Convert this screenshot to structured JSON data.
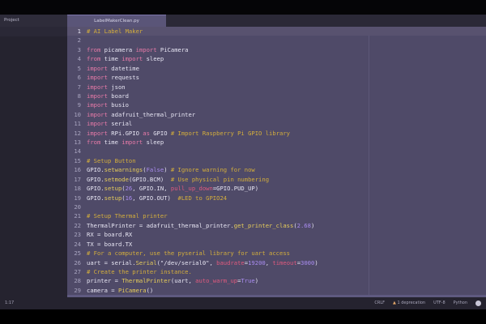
{
  "window": {
    "project_label": "Project",
    "tab_label": "LabelMakerClean.py"
  },
  "status": {
    "cursor": "1:17",
    "line_ending": "CRLF",
    "warning": "1 deprecation",
    "encoding": "UTF-8",
    "language": "Python"
  },
  "code": [
    [
      [
        "# AI Label Maker",
        "cm"
      ]
    ],
    [],
    [
      [
        "from",
        "kw"
      ],
      [
        " picamera ",
        ""
      ],
      [
        "import",
        "kw"
      ],
      [
        " PiCamera",
        ""
      ]
    ],
    [
      [
        "from",
        "kw"
      ],
      [
        " time ",
        ""
      ],
      [
        "import",
        "kw"
      ],
      [
        " sleep",
        ""
      ]
    ],
    [
      [
        "import",
        "kw"
      ],
      [
        " datetime",
        ""
      ]
    ],
    [
      [
        "import",
        "kw"
      ],
      [
        " requests",
        ""
      ]
    ],
    [
      [
        "import",
        "kw"
      ],
      [
        " json",
        ""
      ]
    ],
    [
      [
        "import",
        "kw"
      ],
      [
        " board",
        ""
      ]
    ],
    [
      [
        "import",
        "kw"
      ],
      [
        " busio",
        ""
      ]
    ],
    [
      [
        "import",
        "kw"
      ],
      [
        " adafruit_thermal_printer",
        ""
      ]
    ],
    [
      [
        "import",
        "kw"
      ],
      [
        " serial",
        ""
      ]
    ],
    [
      [
        "import",
        "kw"
      ],
      [
        " RPi.GPIO ",
        ""
      ],
      [
        "as",
        "kw"
      ],
      [
        " GPIO ",
        ""
      ],
      [
        "# Import Raspberry Pi GPIO library",
        "cm"
      ]
    ],
    [
      [
        "from",
        "kw"
      ],
      [
        " time ",
        ""
      ],
      [
        "import",
        "kw"
      ],
      [
        " sleep",
        ""
      ]
    ],
    [],
    [
      [
        "# Setup Button",
        "cm"
      ]
    ],
    [
      [
        "GPIO.",
        ""
      ],
      [
        "setwarnings",
        "fn"
      ],
      [
        "(",
        ""
      ],
      [
        "False",
        "num"
      ],
      [
        ") ",
        ""
      ],
      [
        "# Ignore warning for now",
        "cm"
      ]
    ],
    [
      [
        "GPIO.",
        ""
      ],
      [
        "setmode",
        "fn"
      ],
      [
        "(GPIO.BCM)  ",
        ""
      ],
      [
        "# Use physical pin numbering",
        "cm"
      ]
    ],
    [
      [
        "GPIO.",
        ""
      ],
      [
        "setup",
        "fn"
      ],
      [
        "(",
        ""
      ],
      [
        "26",
        "num"
      ],
      [
        ", GPIO.IN, ",
        ""
      ],
      [
        "pull_up_down",
        "arg"
      ],
      [
        "=GPIO.PUD_UP)",
        ""
      ]
    ],
    [
      [
        "GPIO.",
        ""
      ],
      [
        "setup",
        "fn"
      ],
      [
        "(",
        ""
      ],
      [
        "16",
        "num"
      ],
      [
        ", GPIO.OUT)  ",
        ""
      ],
      [
        "#LED to GPIO24",
        "cm"
      ]
    ],
    [],
    [
      [
        "# Setup Thermal printer",
        "cm"
      ]
    ],
    [
      [
        "ThermalPrinter = adafruit_thermal_printer.",
        ""
      ],
      [
        "get_printer_class",
        "fn"
      ],
      [
        "(",
        ""
      ],
      [
        "2.68",
        "num"
      ],
      [
        ")",
        ""
      ]
    ],
    [
      [
        "RX = board.RX",
        ""
      ]
    ],
    [
      [
        "TX = board.TX",
        ""
      ]
    ],
    [
      [
        "# For a computer, use the pyserial library for uart access",
        "cm"
      ]
    ],
    [
      [
        "uart = serial.",
        ""
      ],
      [
        "Serial",
        "fn"
      ],
      [
        "(\"/dev/serial0\", ",
        ""
      ],
      [
        "baudrate",
        "arg"
      ],
      [
        "=",
        ""
      ],
      [
        "19200",
        "num"
      ],
      [
        ", ",
        ""
      ],
      [
        "timeout",
        "arg"
      ],
      [
        "=",
        ""
      ],
      [
        "3000",
        "num"
      ],
      [
        ")",
        ""
      ]
    ],
    [
      [
        "# Create the printer instance.",
        "cm"
      ]
    ],
    [
      [
        "printer = ",
        ""
      ],
      [
        "ThermalPrinter",
        "fn"
      ],
      [
        "(uart, ",
        ""
      ],
      [
        "auto_warm_up",
        "arg"
      ],
      [
        "=",
        ""
      ],
      [
        "True",
        "num"
      ],
      [
        ")",
        ""
      ]
    ],
    [
      [
        "camera = ",
        ""
      ],
      [
        "PiCamera",
        "fn"
      ],
      [
        "()",
        ""
      ]
    ]
  ]
}
